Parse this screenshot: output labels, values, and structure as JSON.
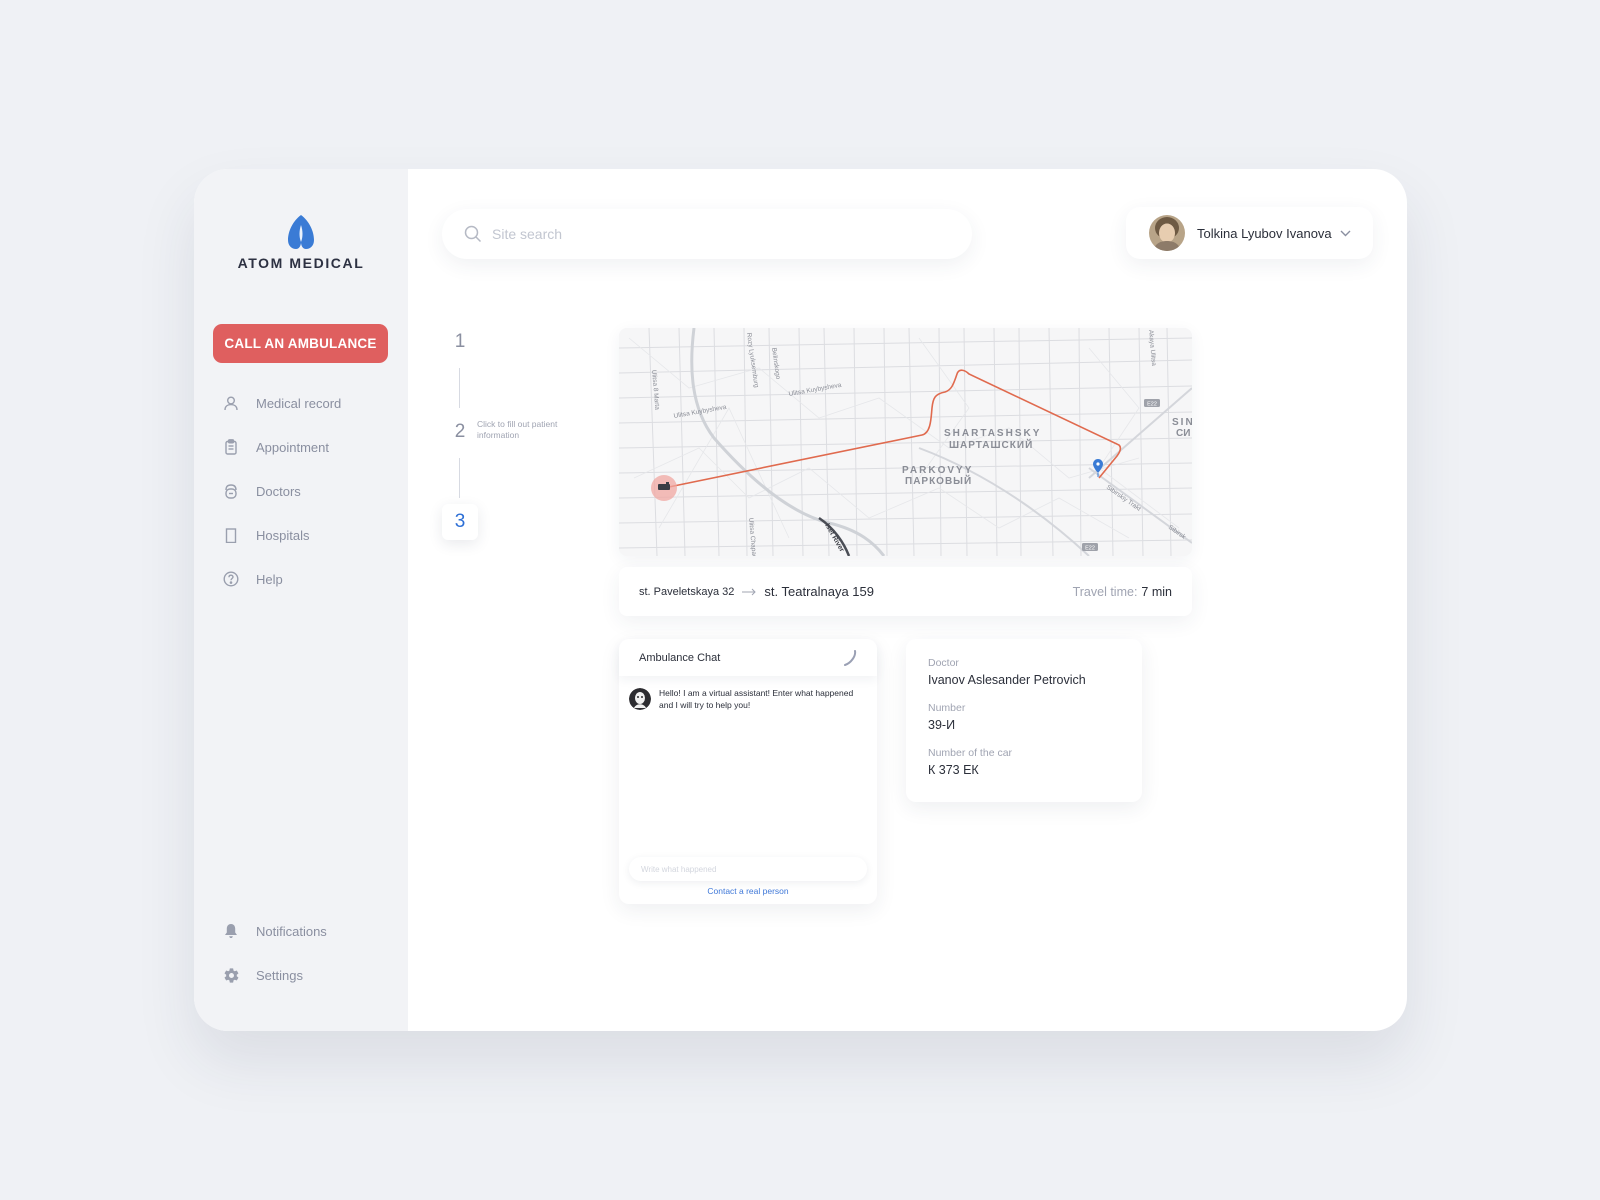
{
  "brand": {
    "name": "ATOM MEDICAL",
    "color": "#3a7bd5"
  },
  "sidebar": {
    "cta_label": "CALL AN AMBULANCE",
    "cta_color": "#df5f5f",
    "items": [
      {
        "label": "Medical record",
        "icon": "user-icon"
      },
      {
        "label": "Appointment",
        "icon": "clipboard-icon"
      },
      {
        "label": "Doctors",
        "icon": "doctor-icon"
      },
      {
        "label": "Hospitals",
        "icon": "hospital-building-icon"
      },
      {
        "label": "Help",
        "icon": "help-circle-icon"
      }
    ],
    "bottom_items": [
      {
        "label": "Notifications",
        "icon": "bell-icon"
      },
      {
        "label": "Settings",
        "icon": "gear-icon"
      }
    ]
  },
  "search": {
    "placeholder": "Site search"
  },
  "user": {
    "name": "Tolkina Lyubov Ivanova"
  },
  "steps": {
    "items": [
      "1",
      "2",
      "3"
    ],
    "active": "3",
    "hint": "Click to fill out patient information"
  },
  "map": {
    "labels": {
      "district1_latin": "SHARTASHSKY",
      "district1_cyr": "ШАРТАШСКИЙ",
      "district2_latin": "PARKOVYY",
      "district2_cyr": "ПАРКОВЫЙ",
      "district3_latin": "SIN",
      "district3_cyr": "СИ",
      "street1": "Ulitsa Kuybysheva",
      "street2": "Ulitsa Kuybysheva",
      "street3": "Ulitsa 8 Marta",
      "street4": "Rozy Lyuksemburg",
      "street5": "Ulitsa Chapaeva",
      "street6": "Iset River",
      "street7": "Sibirskiy Trakt",
      "street8": "Sibirsk",
      "street9": "Akaya Ulitsa",
      "street10": "Belinskogo",
      "badge1": "E22",
      "badge2": "E22"
    },
    "route_color": "#e06a4e",
    "pin_color": "#3a7bd5"
  },
  "route": {
    "from": "st. Paveletskaya 32",
    "to": "st. Teatralnaya 159",
    "travel_label": "Travel time:",
    "travel_value": "7 min"
  },
  "chat": {
    "title": "Ambulance Chat",
    "message": "Hello! I am a virtual assistant! Enter what happened and I will try to help you!",
    "input_placeholder": "Write what happened",
    "contact_link": "Contact a real person"
  },
  "info": {
    "doctor_label": "Doctor",
    "doctor_value": "Ivanov Aslesander Petrovich",
    "number_label": "Number",
    "number_value": "39-И",
    "car_label": "Number of the car",
    "car_value": "К 373 ЕК"
  }
}
